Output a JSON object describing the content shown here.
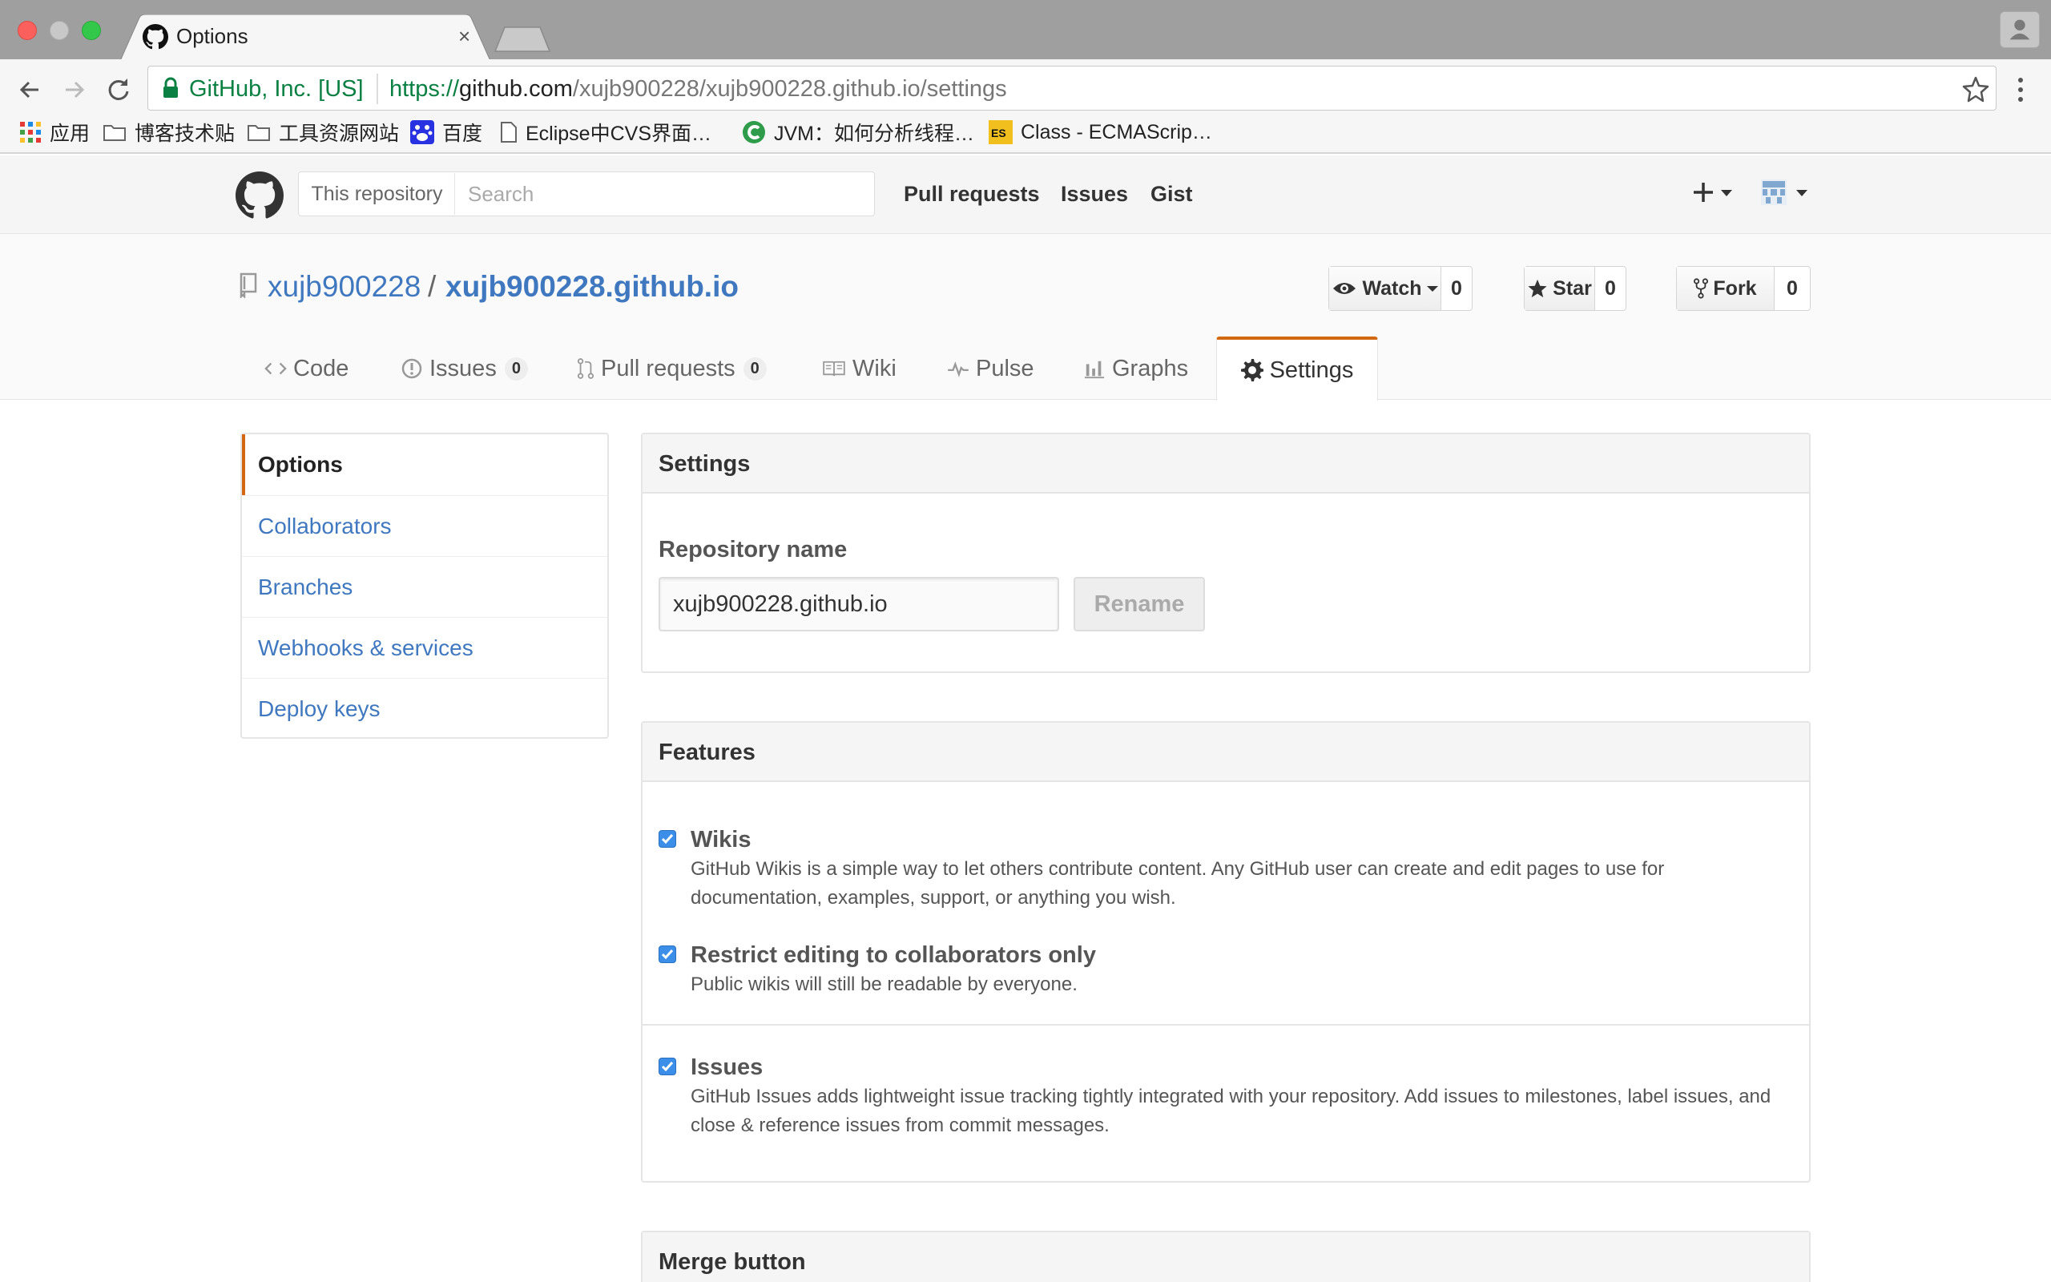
{
  "browser": {
    "tab_title": "Options",
    "tab_close": "×",
    "ev_label": "GitHub, Inc. [US]",
    "url_scheme": "https://",
    "url_host": "github.com",
    "url_path": "/xujb900228/xujb900228.github.io/settings",
    "bookmarks": [
      {
        "label": "应用",
        "icon": "apps-grid-icon"
      },
      {
        "label": "博客技术贴",
        "icon": "folder-icon"
      },
      {
        "label": "工具资源网站",
        "icon": "folder-icon"
      },
      {
        "label": "百度",
        "icon": "baidu-paw-icon"
      },
      {
        "label": "Eclipse中CVS界面…",
        "icon": "page-icon"
      },
      {
        "label": "JVM：如何分析线程…",
        "icon": "c-logo-icon"
      },
      {
        "label": "Class - ECMAScrip…",
        "icon": "es-badge-icon"
      }
    ]
  },
  "header": {
    "scope_label": "This repository",
    "search_placeholder": "Search",
    "nav": [
      "Pull requests",
      "Issues",
      "Gist"
    ]
  },
  "repo": {
    "owner": "xujb900228",
    "slash": "/",
    "name": "xujb900228.github.io",
    "watch_label": "Watch",
    "watch_count": "0",
    "star_label": "Star",
    "star_count": "0",
    "fork_label": "Fork",
    "fork_count": "0",
    "tabs": {
      "code": "Code",
      "issues": "Issues",
      "issues_count": "0",
      "pulls": "Pull requests",
      "pulls_count": "0",
      "wiki": "Wiki",
      "pulse": "Pulse",
      "graphs": "Graphs",
      "settings": "Settings"
    }
  },
  "menu": {
    "items": [
      "Options",
      "Collaborators",
      "Branches",
      "Webhooks & services",
      "Deploy keys"
    ]
  },
  "settings_panel": {
    "title": "Settings",
    "repo_name_label": "Repository name",
    "repo_name_value": "xujb900228.github.io",
    "rename_label": "Rename"
  },
  "features_panel": {
    "title": "Features",
    "items": [
      {
        "title": "Wikis",
        "checked": true,
        "desc": "GitHub Wikis is a simple way to let others contribute content. Any GitHub user can create and edit pages to use for documentation, examples, support, or anything you wish."
      },
      {
        "title": "Restrict editing to collaborators only",
        "checked": true,
        "desc": "Public wikis will still be readable by everyone."
      },
      {
        "title": "Issues",
        "checked": true,
        "desc": "GitHub Issues adds lightweight issue tracking tightly integrated with your repository. Add issues to milestones, label issues, and close & reference issues from commit messages."
      }
    ]
  },
  "merge_panel": {
    "title": "Merge button"
  },
  "colors": {
    "accent_orange": "#d26911",
    "link_blue": "#4078c0",
    "checkbox_blue": "#3b8fe8",
    "secure_green": "#0b8043"
  }
}
